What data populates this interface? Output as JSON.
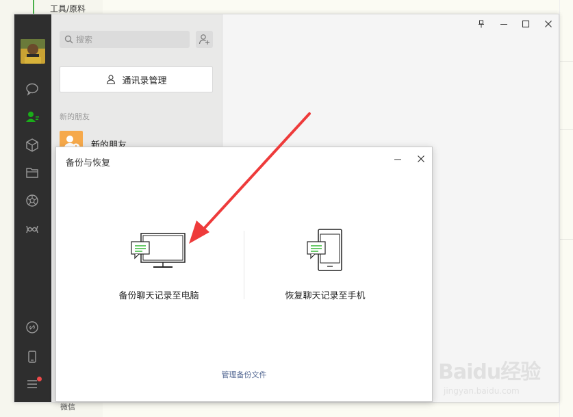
{
  "background": {
    "top_left_text": "工具/原料",
    "bottom_text": "微信"
  },
  "search": {
    "placeholder": "搜索"
  },
  "contacts": {
    "manage_button_label": "通讯录管理",
    "section_label": "新的朋友",
    "new_friends_label": "新的朋友"
  },
  "nav_icons": [
    "chat-icon",
    "contacts-icon",
    "favorites-icon",
    "files-icon",
    "moments-icon",
    "mini-program-icon",
    "link-icon",
    "phone-icon",
    "menu-icon"
  ],
  "dialog": {
    "title": "备份与恢复",
    "backup_option_label": "备份聊天记录至电脑",
    "restore_option_label": "恢复聊天记录至手机",
    "manage_backup_label": "管理备份文件"
  },
  "watermark": {
    "logo": "Baidu经验",
    "url": "jingyan.baidu.com"
  },
  "colors": {
    "accent_green": "#1aad19",
    "arrow_red": "#ee3b3b",
    "link_blue": "#576b95",
    "sidebar_dark": "#2e2e2e"
  }
}
